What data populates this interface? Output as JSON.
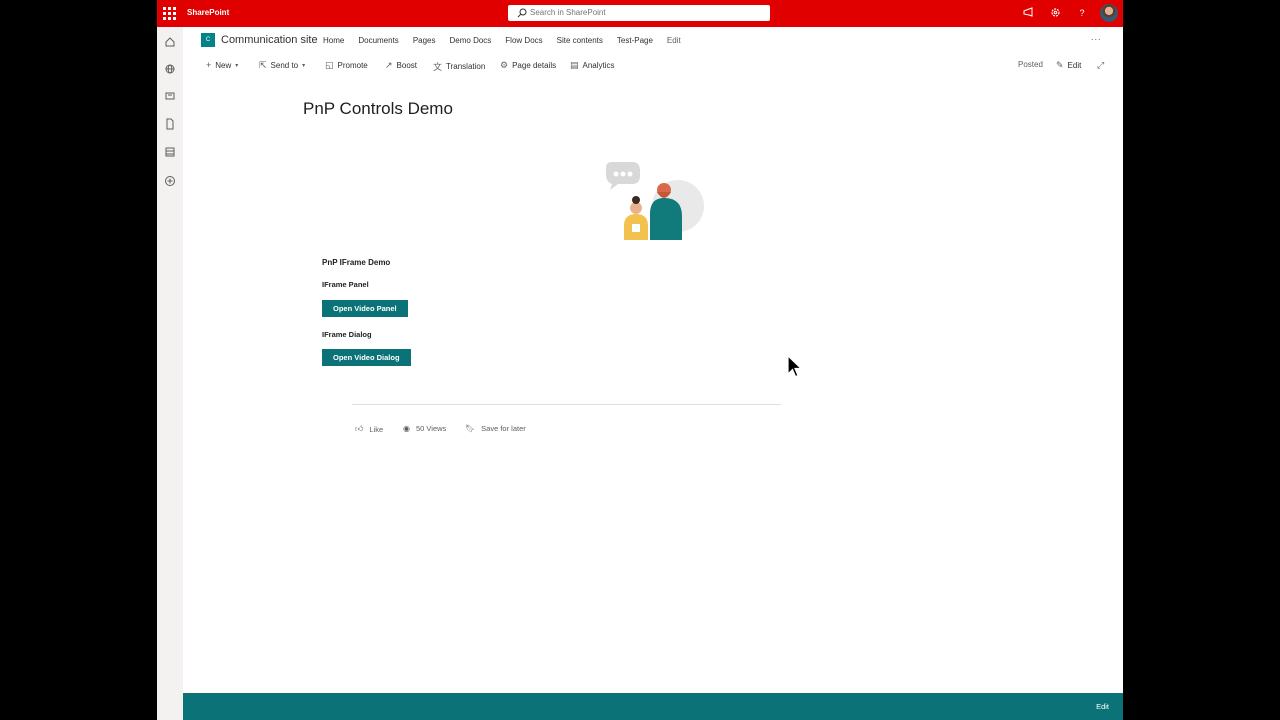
{
  "suite_bar": {
    "app_name": "SharePoint",
    "search_placeholder": "Search in SharePoint",
    "icons": [
      "waffle-icon",
      "megaphone-icon",
      "gear-icon",
      "help-icon",
      "avatar"
    ]
  },
  "rail": {
    "icons": [
      "home-icon",
      "globe-icon",
      "news-icon",
      "document-icon",
      "list-icon",
      "add-icon"
    ]
  },
  "site": {
    "logo_text": "C",
    "title": "Communication site",
    "nav": [
      "Home",
      "Documents",
      "Pages",
      "Demo Docs",
      "Flow Docs",
      "Site contents",
      "Test-Page"
    ],
    "nav_edit": "Edit",
    "more": "..."
  },
  "command_bar": {
    "new": "New",
    "send_to": "Send to",
    "promote": "Promote",
    "boost": "Boost",
    "translation": "Translation",
    "page_details": "Page details",
    "analytics": "Analytics",
    "posted": "Posted",
    "edit": "Edit"
  },
  "page": {
    "title": "PnP Controls Demo",
    "webpart_title": "PnP IFrame Demo",
    "iframe_panel_label": "IFrame Panel",
    "open_video_panel": "Open Video Panel",
    "iframe_dialog_label": "IFrame Dialog",
    "open_video_dialog": "Open Video Dialog"
  },
  "social": {
    "like": "Like",
    "views": "50 Views",
    "save_for_later": "Save for later"
  },
  "footer": {
    "edit": "Edit"
  },
  "colors": {
    "suite_bar": "#e00000",
    "theme": "#0b7377",
    "rail": "#f3f2f1"
  }
}
